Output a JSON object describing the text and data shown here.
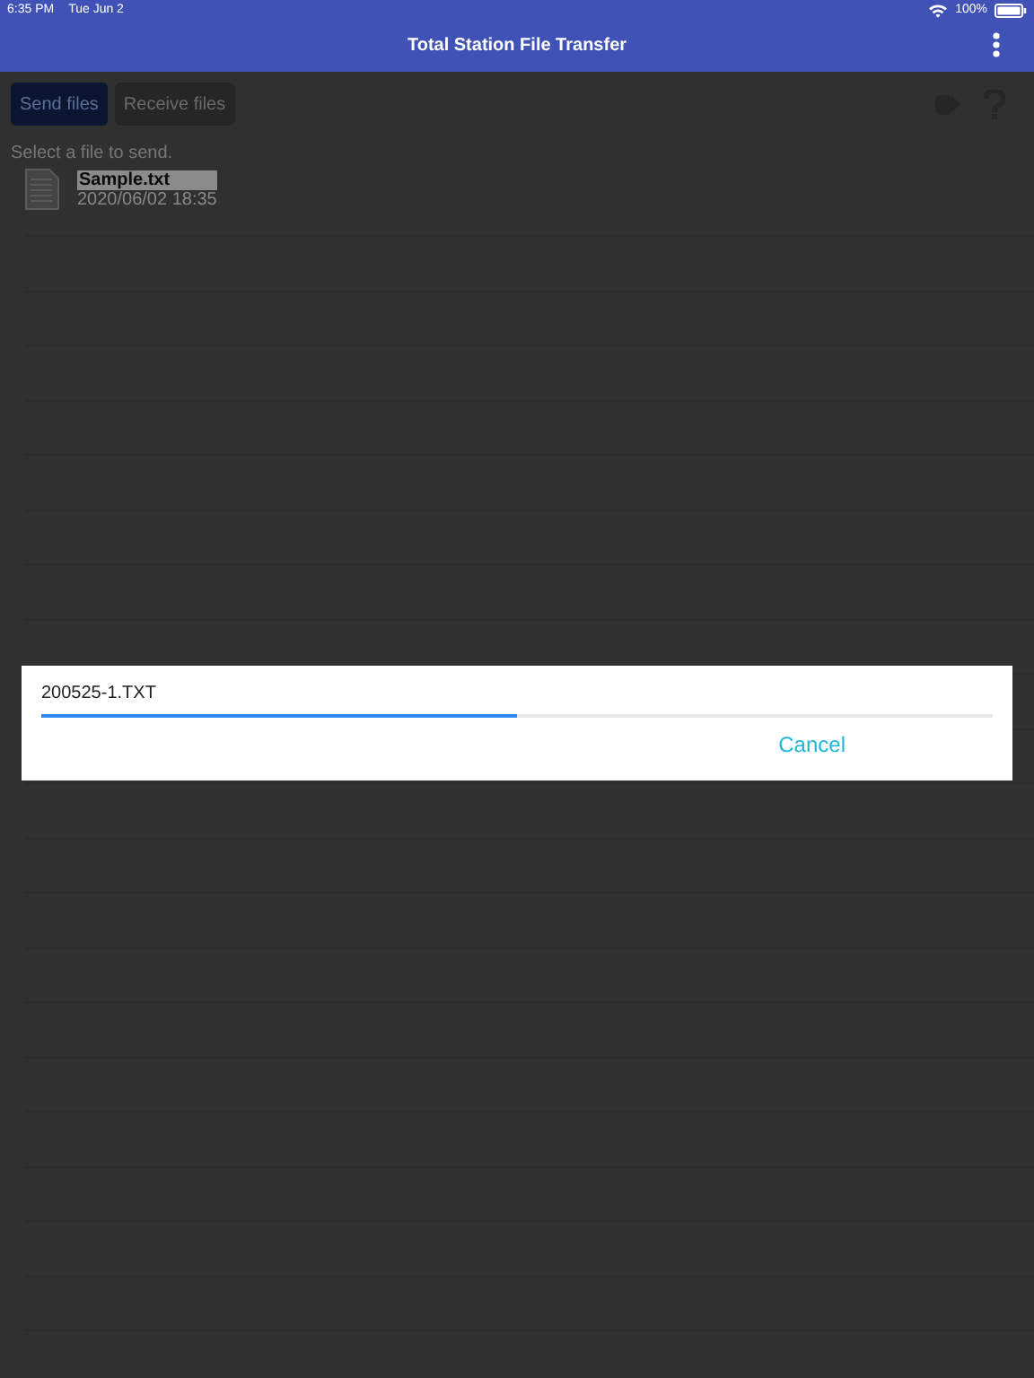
{
  "status_bar": {
    "time": "6:35 PM",
    "date": "Tue Jun 2",
    "battery": "100%"
  },
  "header": {
    "title": "Total Station File Transfer"
  },
  "toolbar": {
    "buttons": [
      {
        "label": "Send files",
        "selected": true
      },
      {
        "label": "Receive files",
        "selected": false
      }
    ]
  },
  "hint": "Select a file to send.",
  "files": [
    {
      "name": "Sample.txt",
      "date": "2020/06/02 18:35"
    }
  ],
  "dialog": {
    "filename": "200525-1.TXT",
    "progress": {
      "level": 0.5
    },
    "button": "Cancel"
  }
}
